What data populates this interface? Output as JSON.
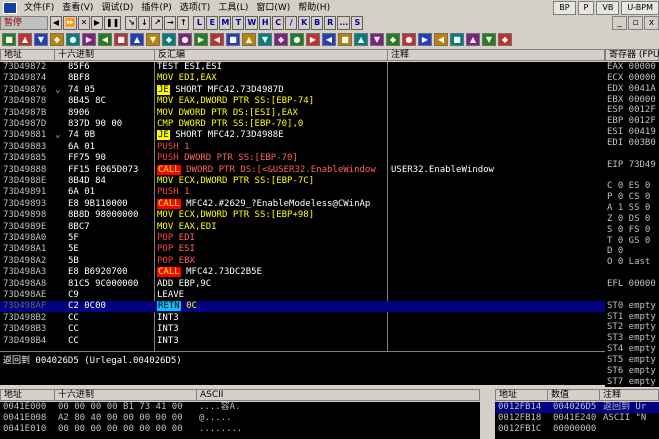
{
  "menu": {
    "items": [
      "文件(F)",
      "查看(V)",
      "调试(D)",
      "插件(P)",
      "选项(T)",
      "工具(L)",
      "窗口(W)",
      "帮助(H)"
    ],
    "right_buttons": [
      "BP",
      "P",
      "VB",
      "U-BPM"
    ]
  },
  "window_controls": [
    "_",
    "▫",
    "x"
  ],
  "status": "暂停",
  "toolbar": {
    "buttons": [
      "◀",
      "⏩",
      "✕",
      "▶",
      "❚❚",
      "↘",
      "↓",
      "↗",
      "→",
      "↑",
      "L",
      "E",
      "M",
      "T",
      "W",
      "H",
      "C",
      "/",
      "K",
      "B",
      "R",
      "...",
      "S"
    ],
    "icons": [
      "arrow-icon",
      "arrow-icon",
      "arrow-icon",
      "arrow-icon",
      "arrow-icon",
      "arrow-icon",
      "arrow-icon",
      "arrow-icon",
      "arrow-icon",
      "arrow-icon",
      "arrow-icon",
      "arrow-icon",
      "arrow-icon",
      "arrow-icon",
      "arrow-icon",
      "arrow-icon",
      "arrow-icon",
      "arrow-icon",
      "arrow-icon",
      "arrow-icon",
      "arrow-icon",
      "arrow-icon",
      "arrow-icon",
      "arrow-icon",
      "arrow-icon",
      "arrow-icon",
      "arrow-icon",
      "arrow-icon",
      "arrow-icon",
      "arrow-icon",
      "arrow-icon",
      "arrow-icon"
    ],
    "icon_glyphs": [
      "■",
      "▲",
      "▼",
      "◆",
      "●",
      "▶",
      "◀",
      "■",
      "▲",
      "▼",
      "◆",
      "●",
      "▶",
      "◀",
      "■",
      "▲",
      "▼",
      "◆",
      "●",
      "▶",
      "◀",
      "■",
      "▲",
      "▼",
      "◆",
      "●",
      "▶",
      "◀",
      "■",
      "▲",
      "▼",
      "◆"
    ],
    "icon_colors": [
      "#208020",
      "#c03030",
      "#2040c0",
      "#c08000",
      "#008080",
      "#802080",
      "#208020",
      "#c03030",
      "#2040c0",
      "#c08000",
      "#008080",
      "#802080",
      "#208020",
      "#c03030",
      "#2040c0",
      "#c08000",
      "#008080",
      "#802080",
      "#208020",
      "#c03030",
      "#2040c0",
      "#c08000",
      "#008080",
      "#802080",
      "#208020",
      "#c03030",
      "#2040c0",
      "#c08000",
      "#008080",
      "#802080",
      "#208020",
      "#c03030"
    ]
  },
  "disasm": {
    "headers": [
      "地址",
      "十六进制",
      "反汇编",
      "注释"
    ],
    "rows": [
      {
        "addr": "73D49872",
        "mark": "",
        "hex": "85F6",
        "op": "TEST",
        "args": " ESI,ESI",
        "kind": "",
        "comment": ""
      },
      {
        "addr": "73D49874",
        "mark": "",
        "hex": "8BF8",
        "op": "MOV",
        "args": " EDI,EAX",
        "kind": "mov",
        "comment": ""
      },
      {
        "addr": "73D49876",
        "mark": "⌄",
        "hex": "74 05",
        "op": "JE",
        "args": " SHORT MFC42.73D4987D",
        "kind": "je",
        "comment": ""
      },
      {
        "addr": "73D49878",
        "mark": "",
        "hex": "8B45 8C",
        "op": "MOV",
        "args": " EAX,DWORD PTR SS:[EBP-74]",
        "kind": "mov",
        "comment": ""
      },
      {
        "addr": "73D4987B",
        "mark": "",
        "hex": "8906",
        "op": "MOV",
        "args": " DWORD PTR DS:[ESI],EAX",
        "kind": "mov",
        "comment": ""
      },
      {
        "addr": "73D4987D",
        "mark": "",
        "hex": "837D 90 00",
        "op": "CMP",
        "args": " DWORD PTR SS:[EBP-70],0",
        "kind": "cmp",
        "comment": ""
      },
      {
        "addr": "73D49881",
        "mark": "⌄",
        "hex": "74 0B",
        "op": "JE",
        "args": " SHORT MFC42.73D4988E",
        "kind": "je",
        "comment": ""
      },
      {
        "addr": "73D49883",
        "mark": "",
        "hex": "6A 01",
        "op": "PUSH",
        "args": " 1",
        "kind": "push",
        "comment": ""
      },
      {
        "addr": "73D49885",
        "mark": "",
        "hex": "FF75 90",
        "op": "PUSH",
        "args": " DWORD PTR SS:[EBP-70]",
        "kind": "push",
        "comment": ""
      },
      {
        "addr": "73D49888",
        "mark": "",
        "hex": "FF15 F065D073",
        "op": "CALL",
        "args": " DWORD PTR DS:[<&USER32.EnableWindow",
        "kind": "call",
        "comment": "USER32.EnableWindow"
      },
      {
        "addr": "73D4988E",
        "mark": "",
        "hex": "8B4D 84",
        "op": "MOV",
        "args": " ECX,DWORD PTR SS:[EBP-7C]",
        "kind": "mov",
        "comment": ""
      },
      {
        "addr": "73D49891",
        "mark": "",
        "hex": "6A 01",
        "op": "PUSH",
        "args": " 1",
        "kind": "push",
        "comment": ""
      },
      {
        "addr": "73D49893",
        "mark": "",
        "hex": "E8 9B110000",
        "op": "CALL",
        "args": " MFC42.#2629_?EnableModeless@CWinAp",
        "kind": "call",
        "comment": ""
      },
      {
        "addr": "73D49898",
        "mark": "",
        "hex": "8B8D 98000000",
        "op": "MOV",
        "args": " ECX,DWORD PTR SS:[EBP+98]",
        "kind": "mov",
        "comment": ""
      },
      {
        "addr": "73D4989E",
        "mark": "",
        "hex": "8BC7",
        "op": "MOV",
        "args": " EAX,EDI",
        "kind": "mov",
        "comment": ""
      },
      {
        "addr": "73D498A0",
        "mark": "",
        "hex": "5F",
        "op": "POP",
        "args": " EDI",
        "kind": "pop",
        "comment": ""
      },
      {
        "addr": "73D498A1",
        "mark": "",
        "hex": "5E",
        "op": "POP",
        "args": " ESI",
        "kind": "pop",
        "comment": ""
      },
      {
        "addr": "73D498A2",
        "mark": "",
        "hex": "5B",
        "op": "POP",
        "args": " EBX",
        "kind": "pop",
        "comment": ""
      },
      {
        "addr": "73D498A3",
        "mark": "",
        "hex": "E8 B6920700",
        "op": "CALL",
        "args": " MFC42.73DC2B5E",
        "kind": "call",
        "comment": ""
      },
      {
        "addr": "73D498A8",
        "mark": "",
        "hex": "81C5 9C000000",
        "op": "ADD",
        "args": " EBP,9C",
        "kind": "",
        "comment": ""
      },
      {
        "addr": "73D498AE",
        "mark": "",
        "hex": "C9",
        "op": "LEAVE",
        "args": "",
        "kind": "",
        "comment": ""
      },
      {
        "addr": "73D498AF",
        "mark": "",
        "hex": "C2 0C00",
        "op": "RETN",
        "args": " 0C",
        "kind": "retn",
        "comment": "",
        "selected": true
      },
      {
        "addr": "73D498B2",
        "mark": "",
        "hex": "CC",
        "op": "INT3",
        "args": "",
        "kind": "",
        "comment": ""
      },
      {
        "addr": "73D498B3",
        "mark": "",
        "hex": "CC",
        "op": "INT3",
        "args": "",
        "kind": "",
        "comment": ""
      },
      {
        "addr": "73D498B4",
        "mark": "",
        "hex": "CC",
        "op": "INT3",
        "args": "",
        "kind": "",
        "comment": ""
      }
    ]
  },
  "info": {
    "line1": "返回到 004026D5 (Urlegal.004026D5)"
  },
  "registers": {
    "header": "寄存器 (FPU)",
    "rows": [
      {
        "t": "EAX 00000",
        "c": "a-red"
      },
      {
        "t": "ECX 00000",
        "c": ""
      },
      {
        "t": "EDX 0041A",
        "c": ""
      },
      {
        "t": "EBX 00000",
        "c": ""
      },
      {
        "t": "ESP 0012F",
        "c": "a-red"
      },
      {
        "t": "EBP 0012F",
        "c": "a-red"
      },
      {
        "t": "ESI 00419",
        "c": ""
      },
      {
        "t": "EDI 003B0",
        "c": ""
      },
      {
        "t": "",
        "c": ""
      },
      {
        "t": "EIP 73D49",
        "c": ""
      },
      {
        "t": "",
        "c": ""
      },
      {
        "t": "C 0  ES 0",
        "c": ""
      },
      {
        "t": "P 0  CS 0",
        "c": ""
      },
      {
        "t": "A 1  SS 0",
        "c": ""
      },
      {
        "t": "Z 0  DS 0",
        "c": ""
      },
      {
        "t": "S 0  FS 0",
        "c": ""
      },
      {
        "t": "T 0  GS 0",
        "c": ""
      },
      {
        "t": "D 0",
        "c": ""
      },
      {
        "t": "O 0  Last",
        "c": ""
      },
      {
        "t": "",
        "c": ""
      },
      {
        "t": "EFL 00000",
        "c": ""
      },
      {
        "t": "",
        "c": ""
      },
      {
        "t": "ST0 empty",
        "c": ""
      },
      {
        "t": "ST1 empty",
        "c": ""
      },
      {
        "t": "ST2 empty",
        "c": ""
      },
      {
        "t": "ST3 empty",
        "c": ""
      },
      {
        "t": "ST4 empty",
        "c": ""
      },
      {
        "t": "ST5 empty",
        "c": ""
      },
      {
        "t": "ST6 empty",
        "c": ""
      },
      {
        "t": "ST7 empty",
        "c": ""
      }
    ]
  },
  "dump": {
    "headers": [
      "地址",
      "十六进制",
      "ASCII"
    ],
    "rows": [
      {
        "addr": "0041E000",
        "hex": "00 00 00 00 B1 73 41 00",
        "ascii": "....容A."
      },
      {
        "addr": "0041E008",
        "hex": "A2 80 40 00 00 00 00 00",
        "ascii": "  @....."
      },
      {
        "addr": "0041E010",
        "hex": "00 00 00 00 00 00 00 00",
        "ascii": "........"
      }
    ]
  },
  "stack": {
    "headers": [
      "地址",
      "数值",
      "注释"
    ],
    "rows": [
      {
        "addr": "0012FB14",
        "val": "004026D5",
        "comment": "返回到 Ur",
        "selected": true
      },
      {
        "addr": "0012FB18",
        "val": "0041E240",
        "comment": "ASCII \"N",
        "selected": false
      },
      {
        "addr": "0012FB1C",
        "val": "00000000",
        "comment": "",
        "selected": false
      }
    ]
  }
}
